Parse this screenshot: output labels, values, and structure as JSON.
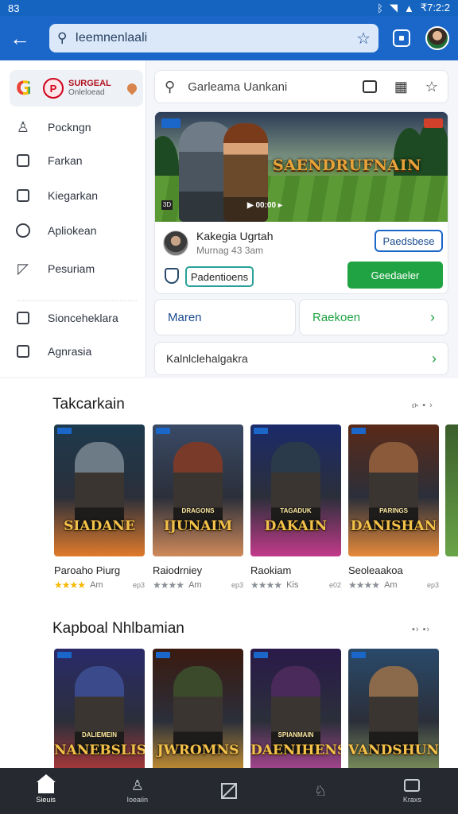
{
  "status_bar": {
    "time_left": "83",
    "time_right": "₹7:2:2",
    "icons": [
      "bluetooth-icon",
      "wifi-icon",
      "signal-icon",
      "battery-icon"
    ]
  },
  "app_bar": {
    "search_text": "Ieemnenlaali",
    "icons": [
      "back-arrow-icon",
      "search-icon",
      "star-icon",
      "square-icon",
      "avatar"
    ]
  },
  "sidebar": {
    "brand_title": "SURGEAL",
    "brand_subtitle": "Onleloead",
    "items": [
      {
        "label": "Pockngn",
        "icon": "person-icon"
      },
      {
        "label": "Farkan",
        "icon": "document-icon"
      },
      {
        "label": "Kiegarkan",
        "icon": "box-icon"
      },
      {
        "label": "Apliokean",
        "icon": "refresh-icon"
      },
      {
        "label": "Pesuriam",
        "icon": "send-icon"
      },
      {
        "label": "Sionceheklara",
        "icon": "box-icon"
      },
      {
        "label": "Agnrasia",
        "icon": "app-icon"
      }
    ]
  },
  "search_card": {
    "text": "Garleama Uankani",
    "icons": [
      "search-icon",
      "message-icon",
      "grid-icon",
      "star-icon"
    ]
  },
  "featured": {
    "banner_title": "SAENDRUFNAIN",
    "banner_controls": "▶ 00:00 ▸",
    "banner_label": "3D",
    "developer_name": "Kakegia Ugrtah",
    "developer_meta": "Murnag 43 3am",
    "follow_label": "Paedsbese",
    "chip_label": "Padentioens",
    "install_label": "Geedaeler"
  },
  "quick_links": [
    {
      "label": "Maren",
      "color": "#1a4b8f"
    },
    {
      "label": "Raekoen",
      "color": "#20a343"
    }
  ],
  "wide_link": "Kalnlclehalgakra",
  "sections": [
    {
      "title": "Takcarkain",
      "more": "ዑ • ›",
      "cards": [
        {
          "name": "Paroaho Piurg",
          "rating_full": 4,
          "size": "Am",
          "downloads": "ep3",
          "cover_title": "SIADANE",
          "cover_sub": "",
          "colors": [
            "#1d3a4e",
            "#e07a2a"
          ],
          "fig": "#6c7b86"
        },
        {
          "name": "Raiodrniey",
          "rating_full": 0,
          "size": "Am",
          "downloads": "ep3",
          "cover_title": "IJUNAIM",
          "cover_sub": "DRAGONS",
          "colors": [
            "#3a4a66",
            "#d08a5a"
          ],
          "fig": "#7a3a2a"
        },
        {
          "name": "Raokiam",
          "rating_full": 0,
          "size": "Kis",
          "downloads": "e02",
          "cover_title": "DAKAIN",
          "cover_sub": "TAGADUK",
          "colors": [
            "#1b2a6a",
            "#c23a8a"
          ],
          "fig": "#2a3a4a"
        },
        {
          "name": "Seoleaakoa",
          "rating_full": 0,
          "size": "Am",
          "downloads": "ep3",
          "cover_title": "DANISHAN",
          "cover_sub": "PARINGS",
          "colors": [
            "#5a2a18",
            "#e68a3a"
          ],
          "fig": "#8a5a3a"
        }
      ]
    },
    {
      "title": "Kapboal Nhlbamian",
      "more": "•› •›",
      "cards": [
        {
          "name": "",
          "cover_title": "NANEBSLIS",
          "cover_sub": "DALIEMEIN",
          "colors": [
            "#2a2a6a",
            "#c23a3a"
          ],
          "fig": "#3a4a8a"
        },
        {
          "name": "",
          "cover_title": "JWROMNS",
          "cover_sub": "",
          "colors": [
            "#3a1a10",
            "#e0a030"
          ],
          "fig": "#3a4a2a"
        },
        {
          "name": "",
          "cover_title": "DAENIHENS",
          "cover_sub": "SPIANMAIN",
          "colors": [
            "#2a1a4a",
            "#c04aa0"
          ],
          "fig": "#4a2a5a"
        },
        {
          "name": "",
          "cover_title": "VANDSHUN",
          "cover_sub": "",
          "colors": [
            "#2a4a6a",
            "#8aa060"
          ],
          "fig": "#8a6a4a"
        }
      ]
    }
  ],
  "bottom_nav": [
    {
      "label": "Sieuis",
      "icon": "home-icon",
      "active": true
    },
    {
      "label": "Ioeaiin",
      "icon": "person-icon",
      "active": false
    },
    {
      "label": "",
      "icon": "slash-square-icon",
      "active": false
    },
    {
      "label": "",
      "icon": "user-icon",
      "active": false
    },
    {
      "label": "Kraxs",
      "icon": "monitor-icon",
      "active": false
    }
  ]
}
